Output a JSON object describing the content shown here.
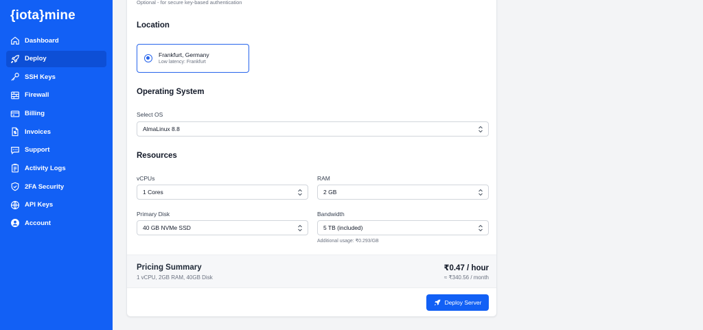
{
  "app": {
    "logo": "{iota}mine"
  },
  "sidebar": {
    "items": [
      {
        "label": "Dashboard",
        "icon": "home-icon"
      },
      {
        "label": "Deploy",
        "icon": "rocket-icon",
        "active": true
      },
      {
        "label": "SSH Keys",
        "icon": "key-icon"
      },
      {
        "label": "Firewall",
        "icon": "firewall-icon"
      },
      {
        "label": "Billing",
        "icon": "credit-card-icon"
      },
      {
        "label": "Invoices",
        "icon": "invoice-icon"
      },
      {
        "label": "Support",
        "icon": "chat-icon"
      },
      {
        "label": "Activity Logs",
        "icon": "clipboard-icon"
      },
      {
        "label": "2FA Security",
        "icon": "shield-icon"
      },
      {
        "label": "API Keys",
        "icon": "globe-icon"
      },
      {
        "label": "Account",
        "icon": "user-icon"
      }
    ]
  },
  "form": {
    "ssh_hint": "Optional - for secure key-based authentication",
    "location": {
      "title": "Location",
      "selected_name": "Frankfurt, Germany",
      "selected_sub": "Low latency: Frankfurt"
    },
    "os": {
      "title": "Operating System",
      "label": "Select OS",
      "value": "AlmaLinux 8.8"
    },
    "resources": {
      "title": "Resources",
      "vcpu_label": "vCPUs",
      "vcpu_value": "1 Cores",
      "ram_label": "RAM",
      "ram_value": "2 GB",
      "disk_label": "Primary Disk",
      "disk_value": "40 GB NVMe SSD",
      "bandwidth_label": "Bandwidth",
      "bandwidth_value": "5 TB (included)",
      "bandwidth_hint": "Additional usage: ₹0.293/GB"
    }
  },
  "pricing": {
    "title": "Pricing Summary",
    "specs": "1 vCPU, 2GB RAM, 40GB Disk",
    "hourly": "₹0.47 / hour",
    "monthly": "≈ ₹340.56 / month"
  },
  "actions": {
    "deploy_label": "Deploy Server"
  },
  "colors": {
    "primary": "#1260f5",
    "active_nav": "#0d4fd6",
    "radio": "#2563eb"
  }
}
